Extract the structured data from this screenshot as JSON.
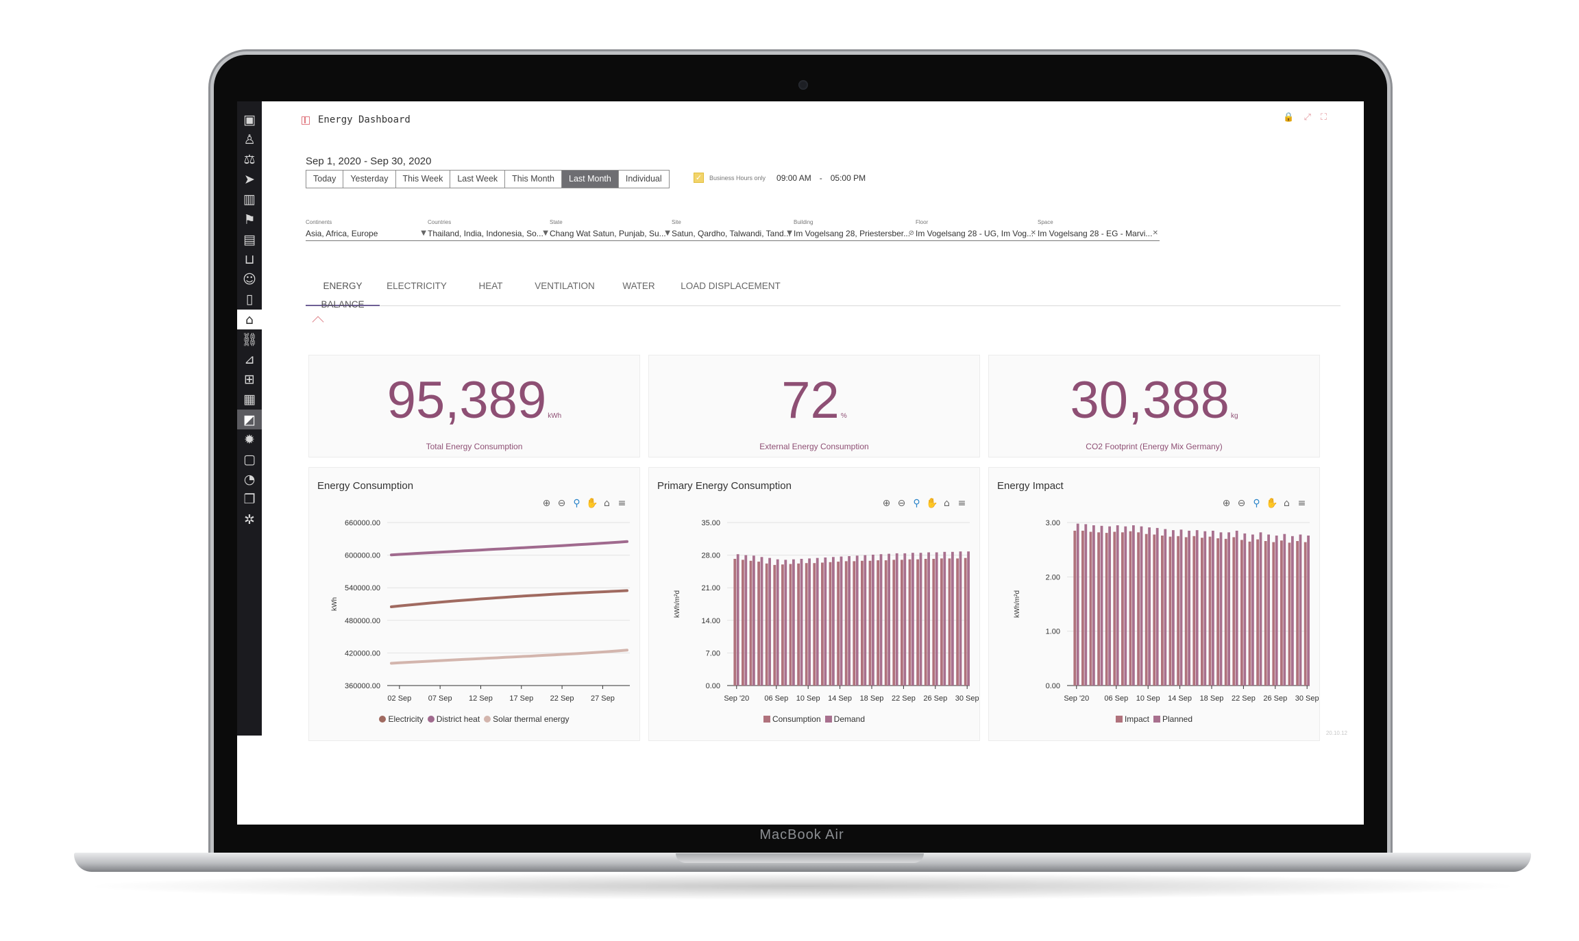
{
  "device": {
    "brand": "MacBook Air"
  },
  "app": {
    "title": "Energy Dashboard",
    "version": "20.10.12"
  },
  "header_actions": [
    {
      "name": "lock-icon",
      "glyph": "🔒"
    },
    {
      "name": "pin-icon",
      "glyph": "⤢"
    },
    {
      "name": "fullscreen-icon",
      "glyph": "⛶"
    }
  ],
  "sidebar": {
    "items": [
      {
        "name": "presentation-icon",
        "glyph": "▣"
      },
      {
        "name": "user-edit-icon",
        "glyph": "♙"
      },
      {
        "name": "scales-icon",
        "glyph": "⚖"
      },
      {
        "name": "send-icon",
        "glyph": "➤"
      },
      {
        "name": "building-icon",
        "glyph": "▥"
      },
      {
        "name": "signpost-icon",
        "glyph": "⚑"
      },
      {
        "name": "ledger-icon",
        "glyph": "▤"
      },
      {
        "name": "cart-icon",
        "glyph": "⊔"
      },
      {
        "name": "person-icon",
        "glyph": "☺"
      },
      {
        "name": "documents-icon",
        "glyph": "▯"
      },
      {
        "name": "home-icon",
        "glyph": "⌂",
        "home": true
      },
      {
        "name": "org-tree-icon",
        "glyph": "⛓"
      },
      {
        "name": "presenter-icon",
        "glyph": "⊿"
      },
      {
        "name": "grid-icon",
        "glyph": "⊞"
      },
      {
        "name": "calendar-grid-icon",
        "glyph": "▦"
      },
      {
        "name": "analytics-icon",
        "glyph": "◩",
        "active": true
      },
      {
        "name": "settings-icon",
        "glyph": "✹"
      },
      {
        "name": "calendar-icon",
        "glyph": "▢"
      },
      {
        "name": "gauge-icon",
        "glyph": "◔"
      },
      {
        "name": "copy-icon",
        "glyph": "❐"
      },
      {
        "name": "network-icon",
        "glyph": "✲"
      }
    ]
  },
  "date_range": "Sep 1, 2020  - Sep 30, 2020",
  "periods": [
    {
      "label": "Today"
    },
    {
      "label": "Yesterday"
    },
    {
      "label": "This Week"
    },
    {
      "label": "Last Week"
    },
    {
      "label": "This Month"
    },
    {
      "label": "Last Month",
      "active": true
    },
    {
      "label": "Individual"
    }
  ],
  "business_hours": {
    "checked": true,
    "label": "Business Hours only",
    "from": "09:00 AM",
    "separator": "-",
    "to": "05:00 PM"
  },
  "filters": [
    {
      "label": "Continents",
      "value": "Asia, Africa, Europe",
      "indicator": "▼"
    },
    {
      "label": "Countries",
      "value": "Thailand, India, Indonesia, So...",
      "indicator": "▼"
    },
    {
      "label": "State",
      "value": "Chang Wat Satun, Punjab, Su...",
      "indicator": "▼"
    },
    {
      "label": "Site",
      "value": "Satun, Qardho, Talwandi, Tand...",
      "indicator": "▼"
    },
    {
      "label": "Building",
      "value": "Im Vogelsang 28, Priestersber...",
      "indicator": "⊘"
    },
    {
      "label": "Floor",
      "value": "Im Vogelsang 28 - UG, Im Vog...",
      "indicator": "✕"
    },
    {
      "label": "Space",
      "value": "Im Vogelsang 28 - EG - Marvi...",
      "indicator": "✕"
    }
  ],
  "tabs": [
    {
      "label": "ENERGY BALANCE",
      "active": true
    },
    {
      "label": "ELECTRICITY"
    },
    {
      "label": "HEAT"
    },
    {
      "label": "VENTILATION"
    },
    {
      "label": "WATER"
    },
    {
      "label": "LOAD DISPLACEMENT"
    }
  ],
  "kpis": [
    {
      "value": "95,389",
      "unit": "kWh",
      "label": "Total Energy Consumption"
    },
    {
      "value": "72",
      "unit": "%",
      "label": "External Energy Consumption"
    },
    {
      "value": "30,388",
      "unit": "kg",
      "label": "CO2 Footprint (Energy Mix Germany)"
    }
  ],
  "chart_toolbar": [
    {
      "name": "zoom-in-icon",
      "glyph": "⊕"
    },
    {
      "name": "zoom-out-icon",
      "glyph": "⊖"
    },
    {
      "name": "selection-zoom-icon",
      "glyph": "⚲",
      "zoom": true
    },
    {
      "name": "pan-hand-icon",
      "glyph": "✋"
    },
    {
      "name": "reset-home-icon",
      "glyph": "⌂"
    },
    {
      "name": "menu-icon",
      "glyph": "≡"
    }
  ],
  "chart_data": [
    {
      "type": "line",
      "title": "Energy Consumption",
      "ylabel": "kWh",
      "ylim": [
        360000,
        660000
      ],
      "yticks": [
        "660000.00",
        "600000.00",
        "540000.00",
        "480000.00",
        "420000.00",
        "360000.00"
      ],
      "xlim": [
        1,
        30
      ],
      "xticks": [
        {
          "x": 2,
          "label": "02 Sep"
        },
        {
          "x": 7,
          "label": "07 Sep"
        },
        {
          "x": 12,
          "label": "12 Sep"
        },
        {
          "x": 17,
          "label": "17 Sep"
        },
        {
          "x": 22,
          "label": "22 Sep"
        },
        {
          "x": 27,
          "label": "27 Sep"
        }
      ],
      "grid": "horizontal",
      "legend_position": "bottom",
      "series": [
        {
          "name": "Electricity",
          "color": "#a06a60",
          "values": [
            505000,
            506500,
            508000,
            509400,
            510800,
            512100,
            513400,
            514700,
            515900,
            517100,
            518200,
            519400,
            520500,
            521500,
            522500,
            523500,
            524500,
            525400,
            526300,
            527200,
            528100,
            528900,
            529700,
            530400,
            531200,
            531900,
            532600,
            533300,
            534000,
            534700
          ]
        },
        {
          "name": "District heat",
          "color": "#a06a8e",
          "values": [
            600500,
            601400,
            602200,
            603100,
            603900,
            604700,
            605500,
            606300,
            607100,
            607900,
            608700,
            609500,
            610300,
            611100,
            611900,
            612700,
            613500,
            614300,
            615100,
            615900,
            616700,
            617500,
            618400,
            619300,
            620200,
            621100,
            622000,
            623000,
            624000,
            625000
          ]
        },
        {
          "name": "Solar thermal energy",
          "color": "#d3b5ad",
          "values": [
            401000,
            401900,
            402700,
            403500,
            404300,
            405100,
            405900,
            406700,
            407400,
            408200,
            408900,
            409700,
            410400,
            411100,
            411900,
            412600,
            413400,
            414100,
            414900,
            415700,
            416500,
            417300,
            418100,
            419000,
            419900,
            420800,
            421800,
            422900,
            424000,
            425200
          ]
        }
      ]
    },
    {
      "type": "bar",
      "title": "Primary Energy Consumption",
      "ylabel": "kWh/m²d",
      "ylim": [
        0,
        35
      ],
      "yticks": [
        "35.00",
        "28.00",
        "21.00",
        "14.00",
        "7.00",
        "0.00"
      ],
      "xticks": [
        {
          "x": 1,
          "label": "Sep '20"
        },
        {
          "x": 6,
          "label": "06 Sep"
        },
        {
          "x": 10,
          "label": "10 Sep"
        },
        {
          "x": 14,
          "label": "14 Sep"
        },
        {
          "x": 18,
          "label": "18 Sep"
        },
        {
          "x": 22,
          "label": "22 Sep"
        },
        {
          "x": 26,
          "label": "26 Sep"
        },
        {
          "x": 30,
          "label": "30 Sep"
        }
      ],
      "categories": [
        1,
        2,
        3,
        4,
        5,
        6,
        7,
        8,
        9,
        10,
        11,
        12,
        13,
        14,
        15,
        16,
        17,
        18,
        19,
        20,
        21,
        22,
        23,
        24,
        25,
        26,
        27,
        28,
        29,
        30
      ],
      "grid": "horizontal",
      "legend_position": "bottom",
      "series": [
        {
          "name": "Consumption",
          "color": "#b0727c",
          "values": [
            27.2,
            27.0,
            26.8,
            26.6,
            26.2,
            25.9,
            26.0,
            26.1,
            26.2,
            26.3,
            26.3,
            26.4,
            26.5,
            26.6,
            26.7,
            26.7,
            26.8,
            26.8,
            26.9,
            26.9,
            27.0,
            27.0,
            27.1,
            27.1,
            27.2,
            27.2,
            27.3,
            27.3,
            27.3,
            27.4
          ]
        },
        {
          "name": "Demand",
          "color": "#a8708e",
          "values": [
            28.2,
            28.0,
            27.9,
            27.6,
            27.4,
            27.1,
            27.0,
            27.1,
            27.2,
            27.3,
            27.4,
            27.5,
            27.6,
            27.7,
            27.8,
            27.9,
            28.0,
            28.1,
            28.2,
            28.3,
            28.4,
            28.4,
            28.5,
            28.5,
            28.6,
            28.6,
            28.7,
            28.7,
            28.8,
            28.8
          ]
        }
      ]
    },
    {
      "type": "bar",
      "title": "Energy Impact",
      "ylabel": "kWh/m²d",
      "ylim": [
        0,
        3
      ],
      "yticks": [
        "3.00",
        "2.00",
        "1.00",
        "0.00"
      ],
      "xticks": [
        {
          "x": 1,
          "label": "Sep '20"
        },
        {
          "x": 6,
          "label": "06 Sep"
        },
        {
          "x": 10,
          "label": "10 Sep"
        },
        {
          "x": 14,
          "label": "14 Sep"
        },
        {
          "x": 18,
          "label": "18 Sep"
        },
        {
          "x": 22,
          "label": "22 Sep"
        },
        {
          "x": 26,
          "label": "26 Sep"
        },
        {
          "x": 30,
          "label": "30 Sep"
        }
      ],
      "categories": [
        1,
        2,
        3,
        4,
        5,
        6,
        7,
        8,
        9,
        10,
        11,
        12,
        13,
        14,
        15,
        16,
        17,
        18,
        19,
        20,
        21,
        22,
        23,
        24,
        25,
        26,
        27,
        28,
        29,
        30
      ],
      "grid": "horizontal",
      "legend_position": "bottom",
      "series": [
        {
          "name": "Impact",
          "color": "#b0727c",
          "values": [
            2.85,
            2.85,
            2.83,
            2.82,
            2.81,
            2.83,
            2.82,
            2.84,
            2.82,
            2.79,
            2.78,
            2.76,
            2.74,
            2.75,
            2.73,
            2.75,
            2.72,
            2.74,
            2.71,
            2.7,
            2.73,
            2.68,
            2.65,
            2.69,
            2.66,
            2.64,
            2.67,
            2.63,
            2.66,
            2.64
          ]
        },
        {
          "name": "Planned",
          "color": "#a8708e",
          "values": [
            2.98,
            2.97,
            2.95,
            2.94,
            2.93,
            2.95,
            2.93,
            2.95,
            2.93,
            2.91,
            2.9,
            2.88,
            2.86,
            2.87,
            2.85,
            2.86,
            2.84,
            2.85,
            2.82,
            2.82,
            2.85,
            2.8,
            2.78,
            2.82,
            2.78,
            2.76,
            2.79,
            2.75,
            2.78,
            2.76
          ]
        }
      ]
    }
  ]
}
